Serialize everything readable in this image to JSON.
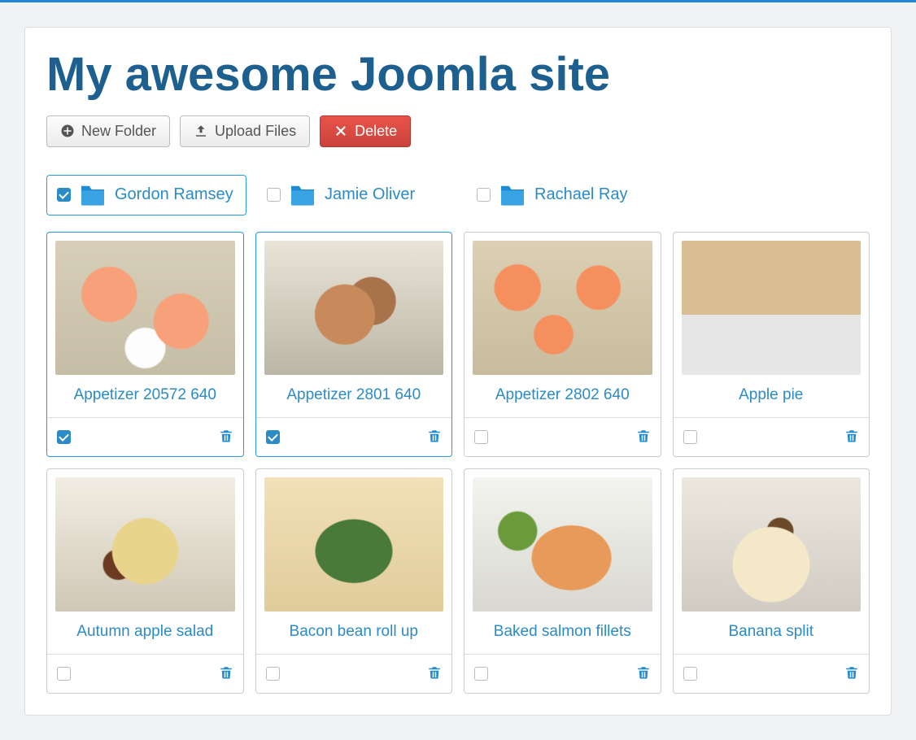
{
  "page_title": "My awesome Joomla site",
  "toolbar": {
    "new_folder": "New Folder",
    "upload_files": "Upload Files",
    "delete": "Delete"
  },
  "folders": [
    {
      "name": "Gordon Ramsey",
      "checked": true
    },
    {
      "name": "Jamie Oliver",
      "checked": false
    },
    {
      "name": "Rachael Ray",
      "checked": false
    }
  ],
  "files": [
    {
      "name": "Appetizer 20572 640",
      "checked": true
    },
    {
      "name": "Appetizer 2801 640",
      "checked": true
    },
    {
      "name": "Appetizer 2802 640",
      "checked": false
    },
    {
      "name": "Apple pie",
      "checked": false
    },
    {
      "name": "Autumn apple salad",
      "checked": false
    },
    {
      "name": "Bacon bean roll up",
      "checked": false
    },
    {
      "name": "Baked salmon fillets",
      "checked": false
    },
    {
      "name": "Banana split",
      "checked": false
    }
  ]
}
